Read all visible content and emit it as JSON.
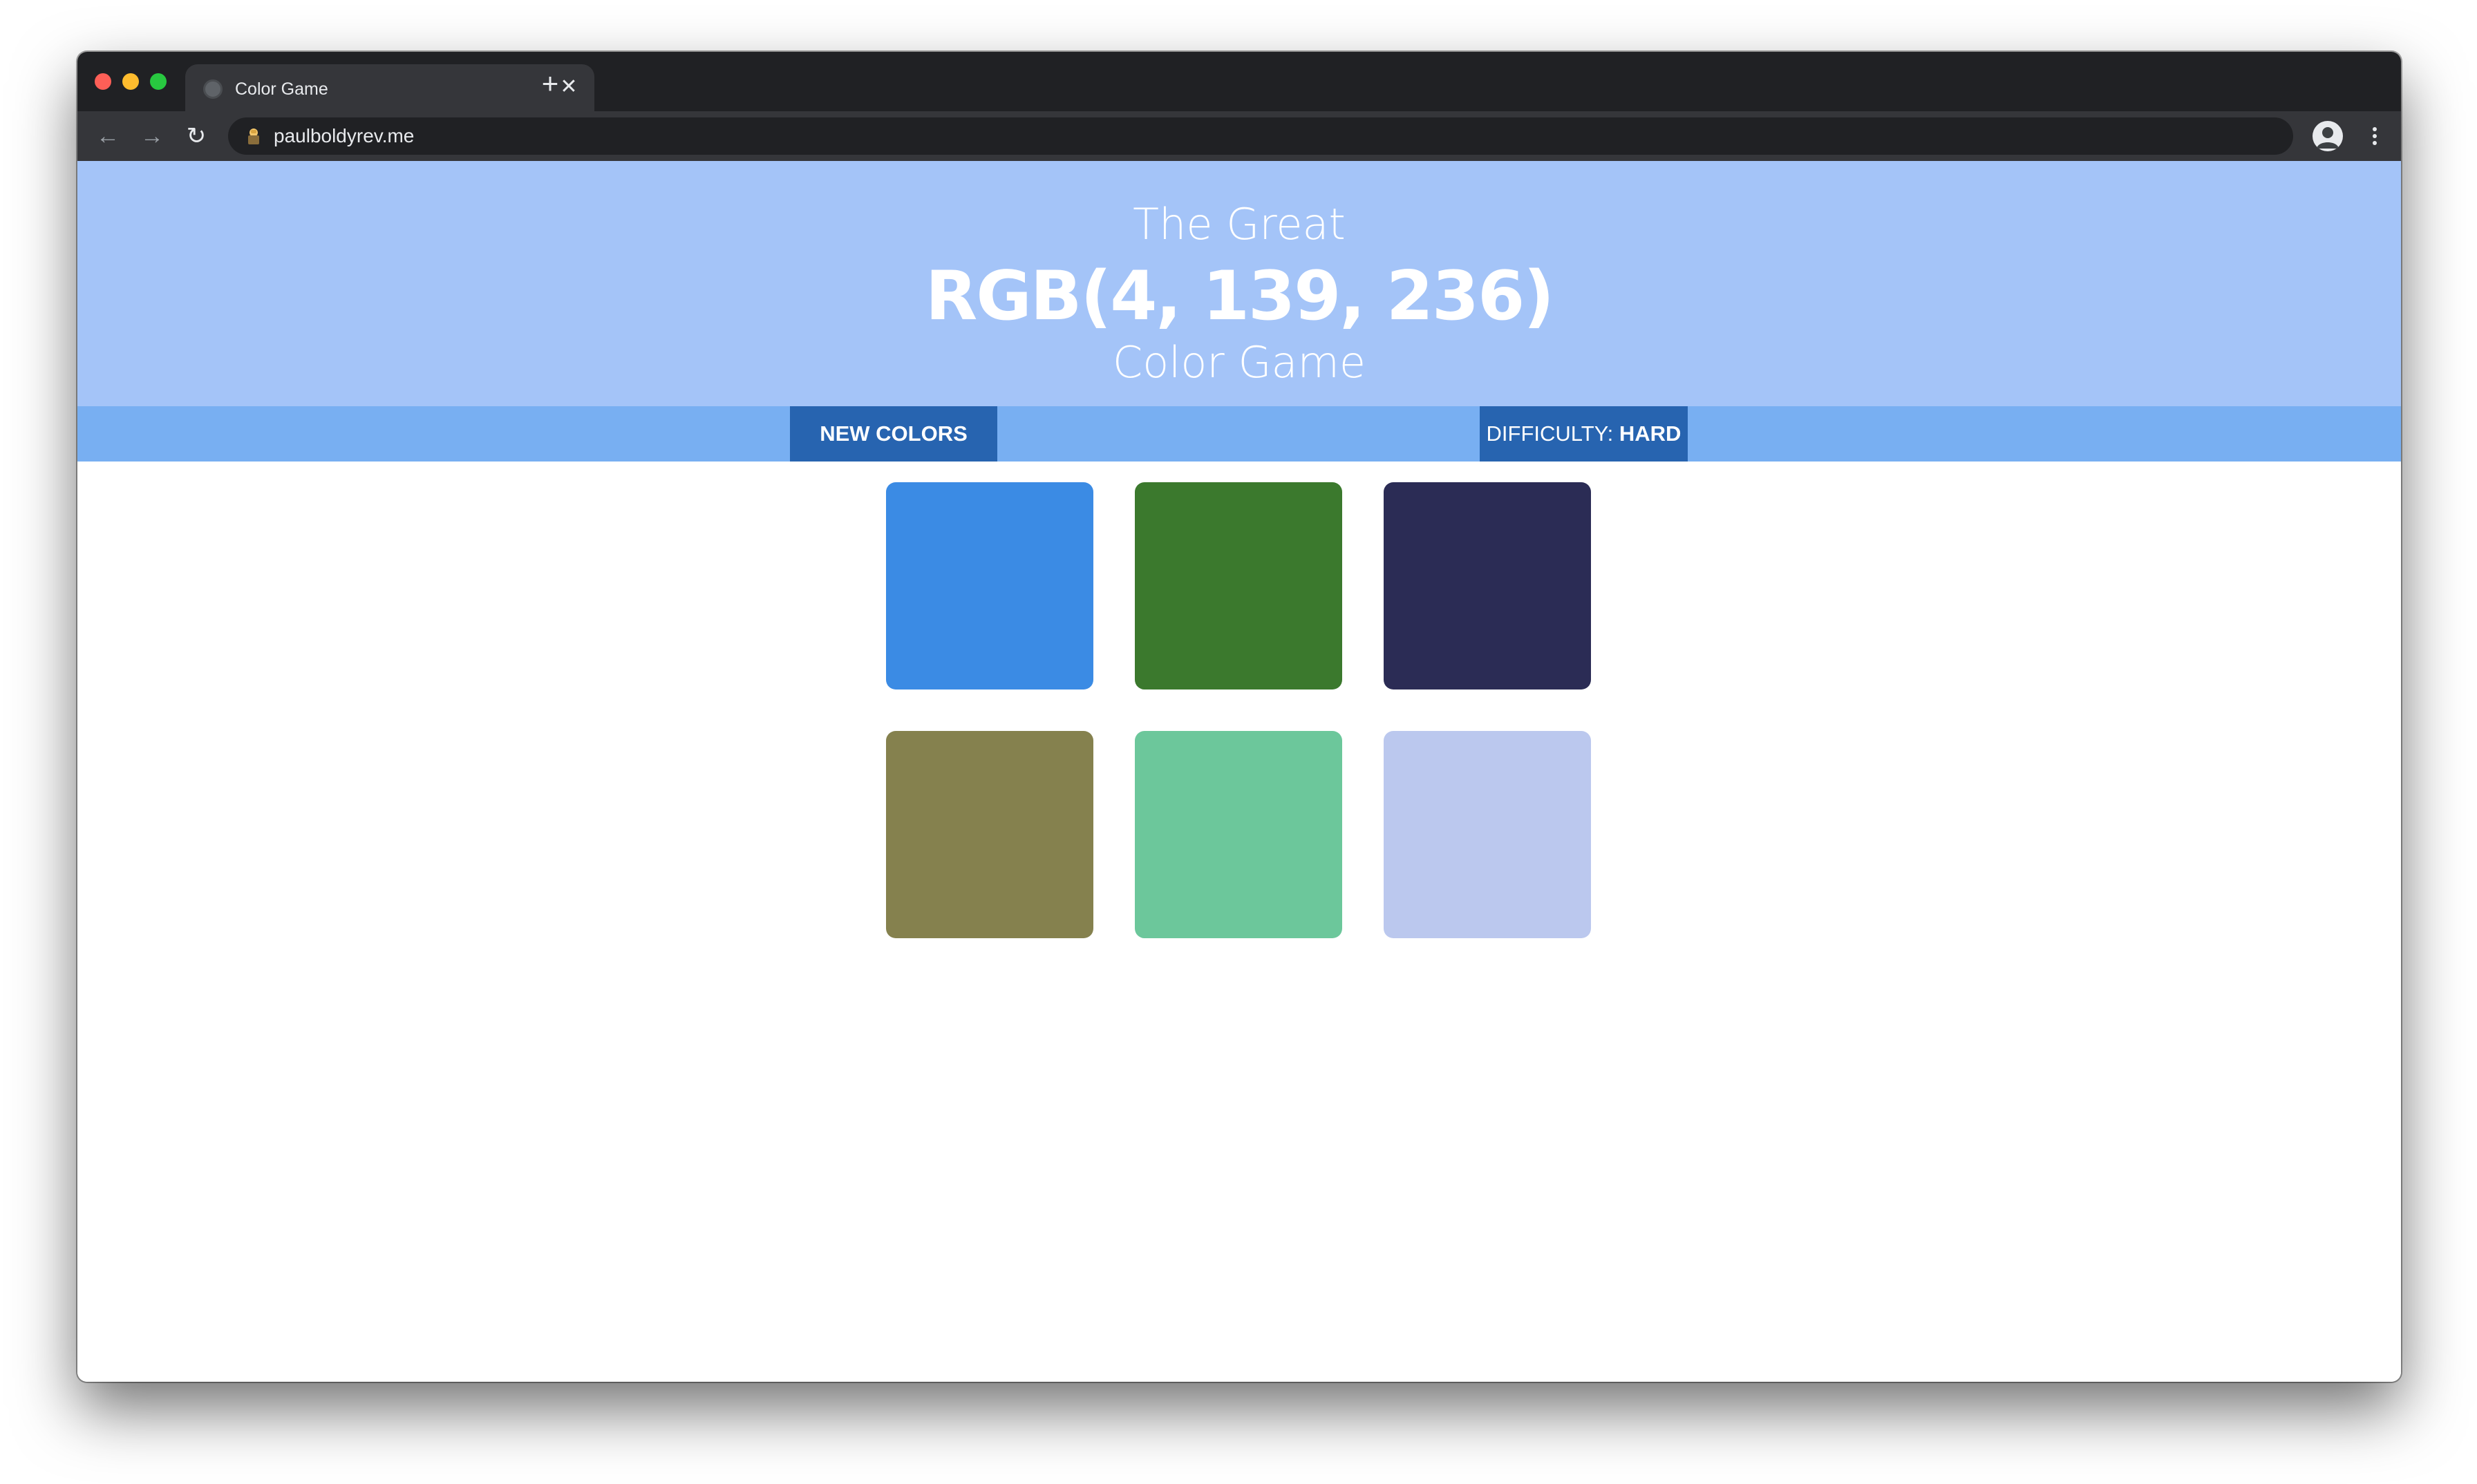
{
  "browser": {
    "tab_title": "Color Game",
    "tab_close": "✕",
    "new_tab": "+",
    "url": "paulboldyrev.me",
    "back": "←",
    "forward": "→",
    "reload": "↻"
  },
  "game": {
    "title_top": "The Great",
    "target_color": "RGB(4, 139, 236)",
    "title_bottom": "Color Game",
    "header_color": "#a4c4f8",
    "stripe_color": "#78aff2",
    "button_color": "#2764b0",
    "new_colors_label": "NEW COLORS",
    "difficulty_label": "DIFFICULTY: ",
    "difficulty_value": "HARD",
    "squares": [
      {
        "color": "#3b8be4"
      },
      {
        "color": "#3b792d"
      },
      {
        "color": "#2b2c55"
      },
      {
        "color": "#85814e"
      },
      {
        "color": "#6cc79b"
      },
      {
        "color": "#bbc8ee"
      }
    ]
  }
}
